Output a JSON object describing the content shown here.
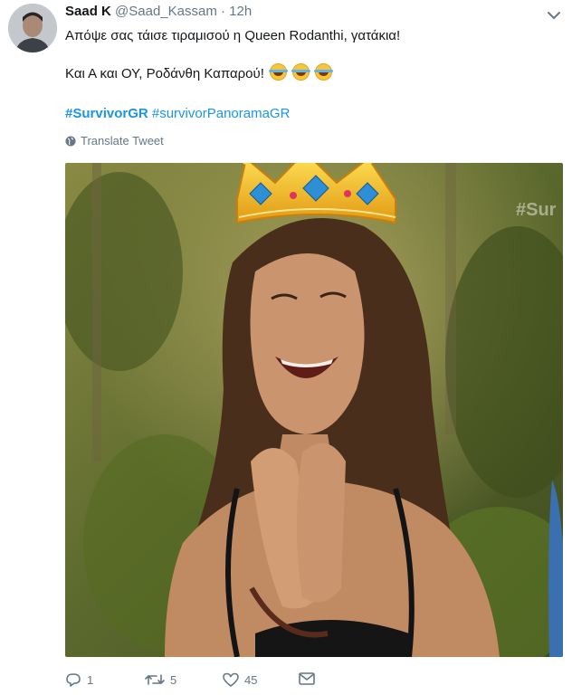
{
  "tweet": {
    "author_name": "Saad K",
    "author_handle": "@Saad_Kassam",
    "separator": "·",
    "time": "12h",
    "line1": "Απόψε σας τάισε τιραμισού η Queen Rodanthi, γατάκια!",
    "line2": "Και Α και ΟΥ, Ροδάνθη Καπαρού!",
    "hashtags": [
      "#SurvivorGR",
      "#survivorPanoramaGR"
    ],
    "translate_label": "Translate Tweet",
    "media_watermark": "#Sur",
    "emoji": [
      "face-with-tears-of-joy",
      "face-with-tears-of-joy",
      "face-with-tears-of-joy"
    ]
  },
  "actions": {
    "reply_count": "1",
    "retweet_count": "5",
    "like_count": "45"
  },
  "colors": {
    "link": "#1b95e0",
    "secondary_text": "#657786",
    "primary_text": "#14171a"
  },
  "icons": {
    "caret": "chevron-down-icon",
    "translate": "globe-icon",
    "reply": "reply-icon",
    "retweet": "retweet-icon",
    "like": "heart-icon",
    "dm": "envelope-icon"
  }
}
